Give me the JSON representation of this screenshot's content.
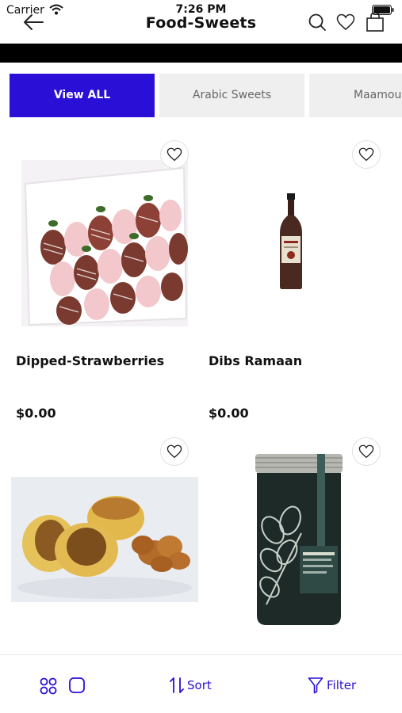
{
  "status_bar": {
    "carrier": "Carrier",
    "time": "7:26 PM"
  },
  "header": {
    "title": "Food-Sweets"
  },
  "icons": {
    "back": "arrow-left-icon",
    "search": "search-icon",
    "wishlist": "heart-icon",
    "cart": "shopping-bag-icon",
    "grid_view": "grid-view-icon",
    "single_view": "single-view-icon",
    "sort": "sort-arrows-icon",
    "filter": "filter-funnel-icon"
  },
  "tabs": [
    {
      "label": "View ALL",
      "active": true
    },
    {
      "label": "Arabic Sweets",
      "active": false
    },
    {
      "label": "Maamoul",
      "active": false
    }
  ],
  "products": [
    {
      "name": "Dipped-Strawberries",
      "price": "$0.00",
      "image": "chocolate-dipped strawberries in white box"
    },
    {
      "name": "Dibs Ramaan",
      "price": "$0.00",
      "image": "bottle of pomegranate molasses"
    },
    {
      "name": "",
      "price": "",
      "image": "maamoul pastries with walnuts"
    },
    {
      "name": "",
      "price": "",
      "image": "jar of carob molasses"
    }
  ],
  "bottom_bar": {
    "sort_label": "Sort",
    "filter_label": "Filter"
  },
  "colors": {
    "accent": "#2a10d6",
    "tab_inactive": "#efefef",
    "band": "#000000"
  }
}
